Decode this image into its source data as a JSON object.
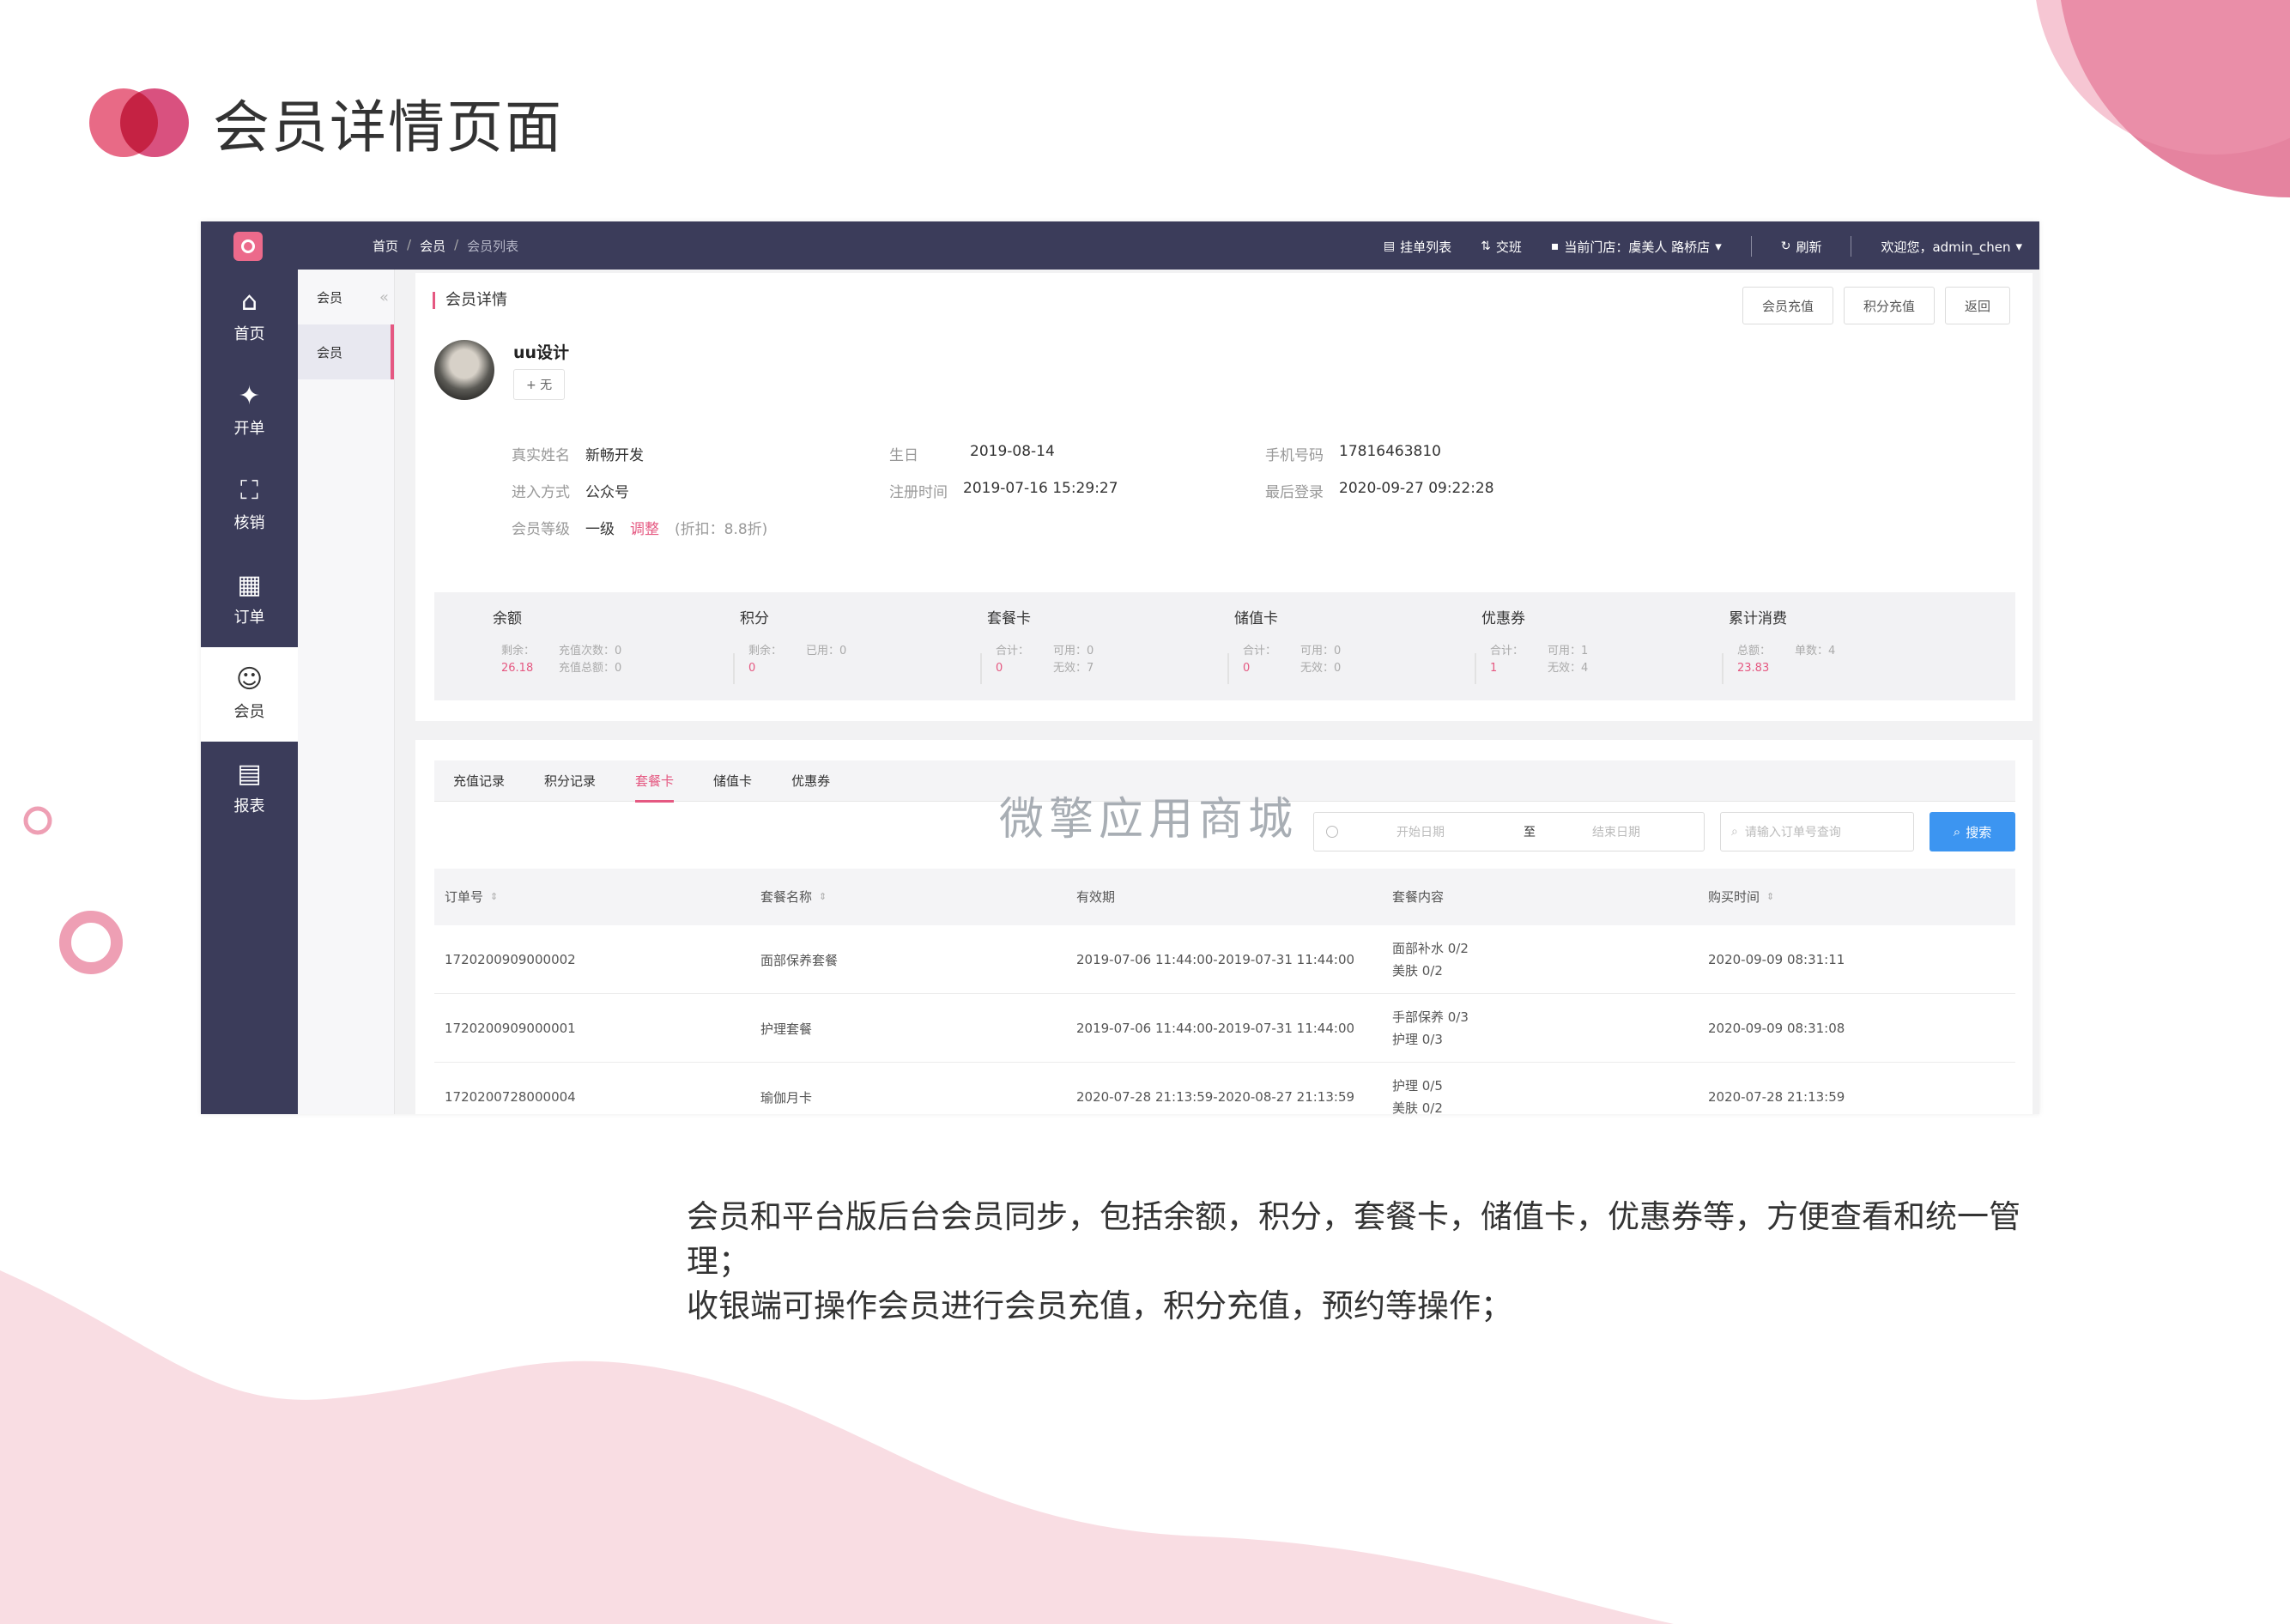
{
  "slide": {
    "title": "会员详情页面",
    "caption_line1": "会员和平台版后台会员同步，包括余额，积分，套餐卡，储值卡，优惠券等，方便查看和统一管理；",
    "caption_line2": "收银端可操作会员进行会员充值，积分充值，预约等操作；",
    "colors": {
      "accent": "#e55881",
      "sidebar": "#3b3c5a",
      "primary_button": "#3c95f1",
      "wave": "#f9dde3"
    }
  },
  "topbar": {
    "breadcrumb": [
      "首页",
      "会员",
      "会员列表"
    ],
    "breadcrumb_sep": "/",
    "nav": {
      "orders": "挂单列表",
      "handover": "交班",
      "store": "当前门店：虞美人 路桥店",
      "refresh": "刷新",
      "welcome": "欢迎您，admin_chen"
    }
  },
  "sidebar": {
    "items": [
      {
        "label": "首页",
        "icon": "home-icon"
      },
      {
        "label": "开单",
        "icon": "compass-icon"
      },
      {
        "label": "核销",
        "icon": "scan-icon"
      },
      {
        "label": "订单",
        "icon": "clipboard-icon"
      },
      {
        "label": "会员",
        "icon": "user-icon"
      },
      {
        "label": "报表",
        "icon": "report-icon"
      }
    ]
  },
  "subnav": {
    "head": "会员",
    "item": "会员"
  },
  "detail": {
    "title": "会员详情",
    "buttons": {
      "recharge": "会员充值",
      "points": "积分充值",
      "back": "返回"
    },
    "name": "uu设计",
    "tag": "+ 无",
    "fields": {
      "real_name_label": "真实姓名",
      "real_name": "新畅开发",
      "birthday_label": "生日",
      "birthday": "2019-08-14",
      "phone_label": "手机号码",
      "phone": "17816463810",
      "source_label": "进入方式",
      "source": "公众号",
      "reg_label": "注册时间",
      "reg": "2019-07-16 15:29:27",
      "last_label": "最后登录",
      "last": "2020-09-27 09:22:28",
      "level_label": "会员等级",
      "level": "一级",
      "adjust": "调整",
      "discount": "(折扣：8.8折)"
    }
  },
  "stats": [
    {
      "title": "余额",
      "a_label": "剩余：",
      "a_value": "26.18",
      "b1": "充值次数：0",
      "b2": "充值总额：0"
    },
    {
      "title": "积分",
      "a_label": "剩余：",
      "a_value": "0",
      "b1": "已用：0",
      "b2": ""
    },
    {
      "title": "套餐卡",
      "a_label": "合计：",
      "a_value": "0",
      "b1": "可用：0",
      "b2": "无效：7"
    },
    {
      "title": "储值卡",
      "a_label": "合计：",
      "a_value": "0",
      "b1": "可用：0",
      "b2": "无效：0"
    },
    {
      "title": "优惠券",
      "a_label": "合计：",
      "a_value": "1",
      "b1": "可用：1",
      "b2": "无效：4"
    },
    {
      "title": "累计消费",
      "a_label": "总额：",
      "a_value": "23.83",
      "b1": "单数：4",
      "b2": ""
    }
  ],
  "list": {
    "tabs": [
      "充值记录",
      "积分记录",
      "套餐卡",
      "储值卡",
      "优惠券"
    ],
    "active_tab": "套餐卡",
    "watermark": "微擎应用商城",
    "date_start": "开始日期",
    "date_to": "至",
    "date_end": "结束日期",
    "search_placeholder": "请输入订单号查询",
    "search_btn": "搜索",
    "columns": [
      "订单号",
      "套餐名称",
      "有效期",
      "套餐内容",
      "购买时间"
    ],
    "rows": [
      {
        "order": "1720200909000002",
        "name": "面部保养套餐",
        "period": "2019-07-06 11:44:00-2019-07-31 11:44:00",
        "c1": "面部补水 0/2",
        "c2": "美肤 0/2",
        "time": "2020-09-09 08:31:11"
      },
      {
        "order": "1720200909000001",
        "name": "护理套餐",
        "period": "2019-07-06 11:44:00-2019-07-31 11:44:00",
        "c1": "手部保养 0/3",
        "c2": "护理 0/3",
        "time": "2020-09-09 08:31:08"
      },
      {
        "order": "1720200728000004",
        "name": "瑜伽月卡",
        "period": "2020-07-28 21:13:59-2020-08-27 21:13:59",
        "c1": "护理 0/5",
        "c2": "美肤 0/2",
        "time": "2020-07-28 21:13:59"
      }
    ]
  }
}
